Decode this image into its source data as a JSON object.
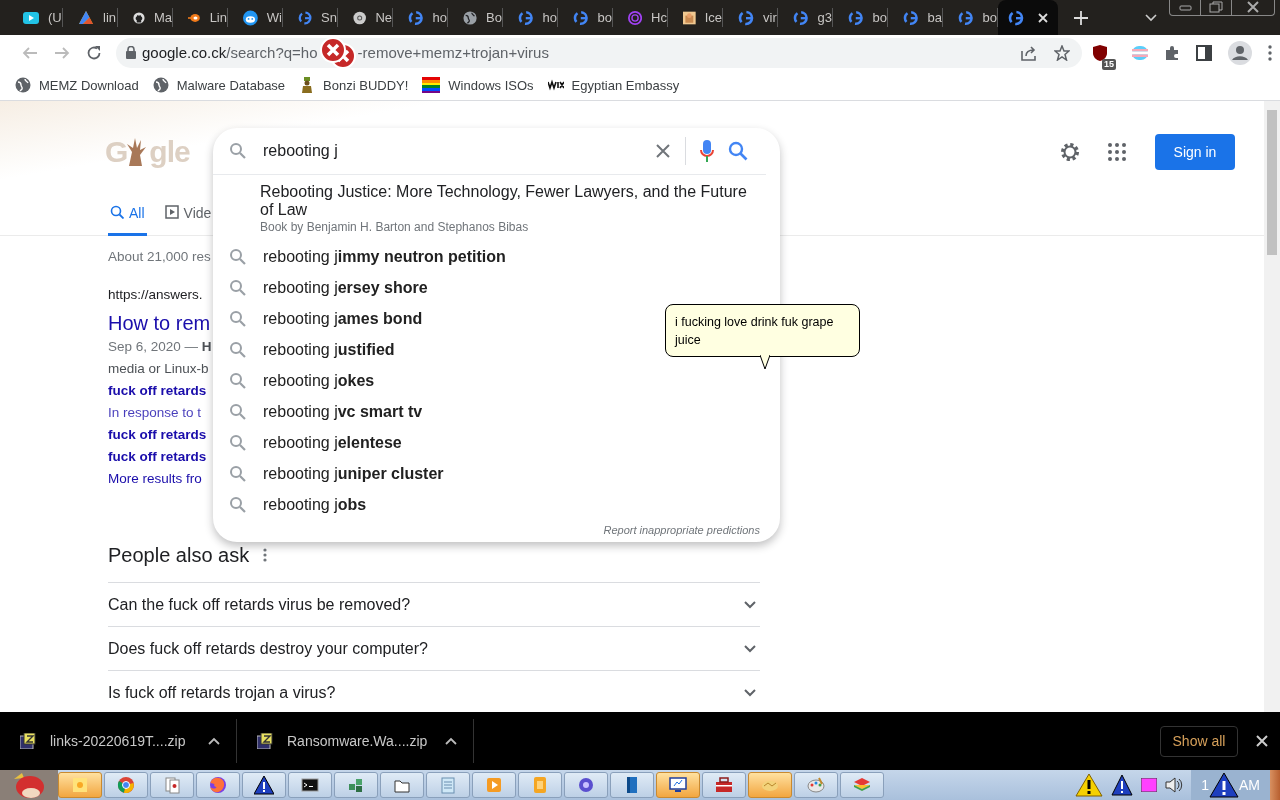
{
  "tabs": [
    {
      "kind": "play",
      "title": "(U",
      "selected": false
    },
    {
      "kind": "triangle",
      "title": "lin",
      "selected": false
    },
    {
      "kind": "cat",
      "title": "Ma",
      "selected": false
    },
    {
      "kind": "swirl",
      "title": "Lin",
      "selected": false
    },
    {
      "kind": "alien",
      "title": "Wi",
      "selected": false
    },
    {
      "kind": "g",
      "title": "Sn",
      "selected": false
    },
    {
      "kind": "wheel",
      "title": "Ne",
      "selected": false
    },
    {
      "kind": "g",
      "title": "ho",
      "selected": false
    },
    {
      "kind": "globe",
      "title": "Bo",
      "selected": false
    },
    {
      "kind": "g",
      "title": "ho",
      "selected": false
    },
    {
      "kind": "g",
      "title": "bo",
      "selected": false
    },
    {
      "kind": "ring",
      "title": "Hc",
      "selected": false
    },
    {
      "kind": "photo",
      "title": "Ice",
      "selected": false
    },
    {
      "kind": "g",
      "title": "vir",
      "selected": false
    },
    {
      "kind": "g",
      "title": "g3",
      "selected": false
    },
    {
      "kind": "g",
      "title": "bo",
      "selected": false
    },
    {
      "kind": "g",
      "title": "ba",
      "selected": false
    },
    {
      "kind": "g",
      "title": "bo",
      "selected": false
    },
    {
      "kind": "g",
      "selected": true
    }
  ],
  "address": {
    "url_start": "google.co.ck",
    "url_path": "/search?q=ho",
    "url_end": "-remove+memz+trojan+virus"
  },
  "extension_badge": "15",
  "bookmarks": [
    {
      "kind": "globe",
      "label": "MEMZ Download"
    },
    {
      "kind": "globe",
      "label": "Malware Database"
    },
    {
      "kind": "figure",
      "label": "Bonzi BUDDY!"
    },
    {
      "kind": "rainbow",
      "label": "Windows ISOs"
    },
    {
      "kind": "zigzag",
      "label": "Egyptian Embassy"
    }
  ],
  "google": {
    "logo_start": "G",
    "logo_end": "gle",
    "search": {
      "value": "rebooting j"
    },
    "suggestions": [
      {
        "kind": "entity",
        "title": "Rebooting Justice: More Technology, Fewer Lawyers, and the Future of Law",
        "subtitle": "Book by Benjamin H. Barton and Stephanos Bibas"
      },
      {
        "kind": "query",
        "text": "rebooting j**immy neutron petition**"
      },
      {
        "kind": "query",
        "text": "rebooting j**ersey shore**"
      },
      {
        "kind": "query",
        "text": "rebooting j**ames bond**"
      },
      {
        "kind": "query",
        "text": "rebooting j**ustified**"
      },
      {
        "kind": "query",
        "text": "rebooting j**okes**"
      },
      {
        "kind": "query",
        "text": "rebooting j**vc smart tv**"
      },
      {
        "kind": "query",
        "text": "rebooting j**elentese**"
      },
      {
        "kind": "query",
        "text": "rebooting j**uniper cluster**"
      },
      {
        "kind": "query",
        "text": "rebooting j**obs**"
      }
    ],
    "report_link": "Report inappropriate predictions",
    "sign_in": "Sign in",
    "tabs": [
      {
        "kind": "search",
        "label": "All",
        "selected": true
      },
      {
        "kind": "video",
        "label": "Vide",
        "selected": false
      }
    ],
    "result_stats": "About 21,000 res",
    "result": {
      "url": "https://answers.",
      "title": "How to rem",
      "date": "Sep 6, 2020 — ",
      "snippet_start": "H",
      "snippet_line": "media or Linux-b",
      "sitelinks": [
        {
          "kind": "link",
          "text": "fuck off retards"
        },
        {
          "kind": "text",
          "text": "In response to t"
        },
        {
          "kind": "link",
          "text": "fuck off retards"
        },
        {
          "kind": "link",
          "text": "fuck off retards"
        }
      ],
      "more": "More results fro"
    },
    "people_also_ask": {
      "title": "People also ask",
      "questions": [
        "Can the fuck off retards virus be removed?",
        "Does fuck off retards destroy your computer?",
        "Is fuck off retards trojan a virus?"
      ]
    }
  },
  "tooltip": "i fucking love drink fuk grape juice",
  "downloads": {
    "items": [
      {
        "name": "links-20220619T....zip"
      },
      {
        "name": "Ransomware.Wa....zip"
      }
    ],
    "show_all": "Show all"
  },
  "taskbar": {
    "apps": [
      {
        "kind": "note",
        "highlighted": true
      },
      {
        "kind": "chrome",
        "highlighted": false
      },
      {
        "kind": "cards",
        "highlighted": false
      },
      {
        "kind": "fox",
        "highlighted": false
      },
      {
        "kind": "warning",
        "highlighted": false
      },
      {
        "kind": "terminal",
        "highlighted": false
      },
      {
        "kind": "cubes",
        "highlighted": false
      },
      {
        "kind": "folder",
        "highlighted": false
      },
      {
        "kind": "notepad",
        "highlighted": false
      },
      {
        "kind": "play",
        "highlighted": false
      },
      {
        "kind": "tile",
        "highlighted": false
      },
      {
        "kind": "gear",
        "highlighted": false
      },
      {
        "kind": "book",
        "highlighted": false
      },
      {
        "kind": "monitor",
        "highlighted": true
      },
      {
        "kind": "toolbox",
        "highlighted": false
      },
      {
        "kind": "hands",
        "highlighted": true
      },
      {
        "kind": "palette",
        "highlighted": false
      },
      {
        "kind": "layers",
        "highlighted": false
      }
    ],
    "clock_start": "1",
    "clock_end": "AM"
  }
}
